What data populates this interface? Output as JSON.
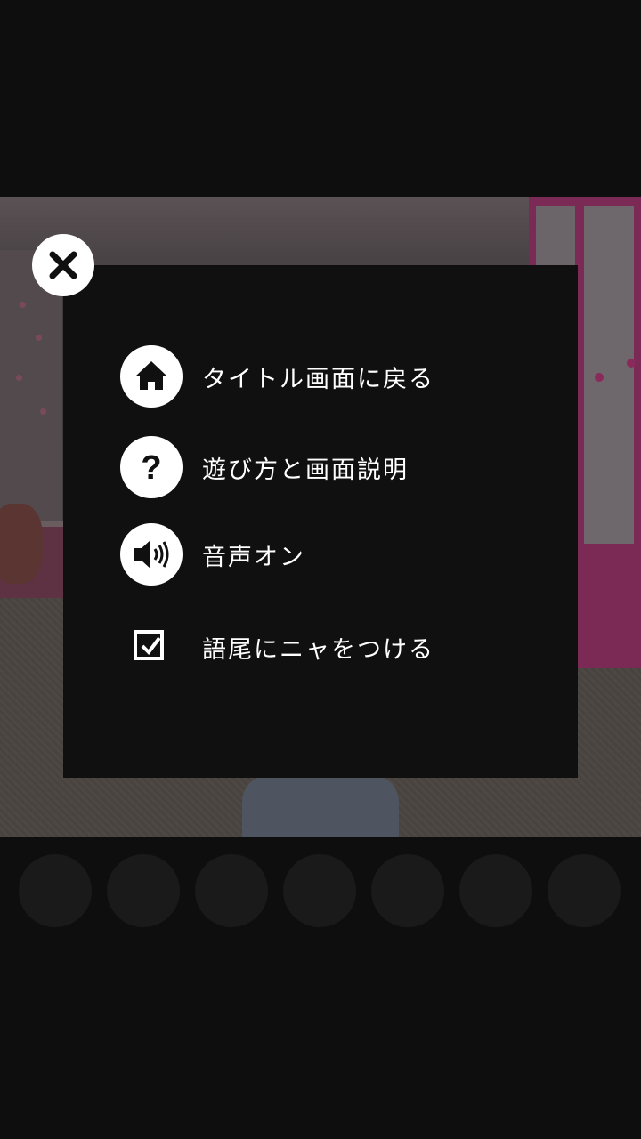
{
  "menu": {
    "items": [
      {
        "label": "タイトル画面に戻る",
        "icon": "home-icon"
      },
      {
        "label": "遊び方と画面説明",
        "icon": "question-icon"
      },
      {
        "label": "音声オン",
        "icon": "speaker-icon"
      }
    ],
    "option": {
      "label": "語尾にニャをつける",
      "checked": true
    }
  },
  "close": {
    "icon": "close-icon"
  },
  "colors": {
    "panel": "#101010",
    "icon_bg": "#ffffff",
    "text": "#ffffff"
  }
}
